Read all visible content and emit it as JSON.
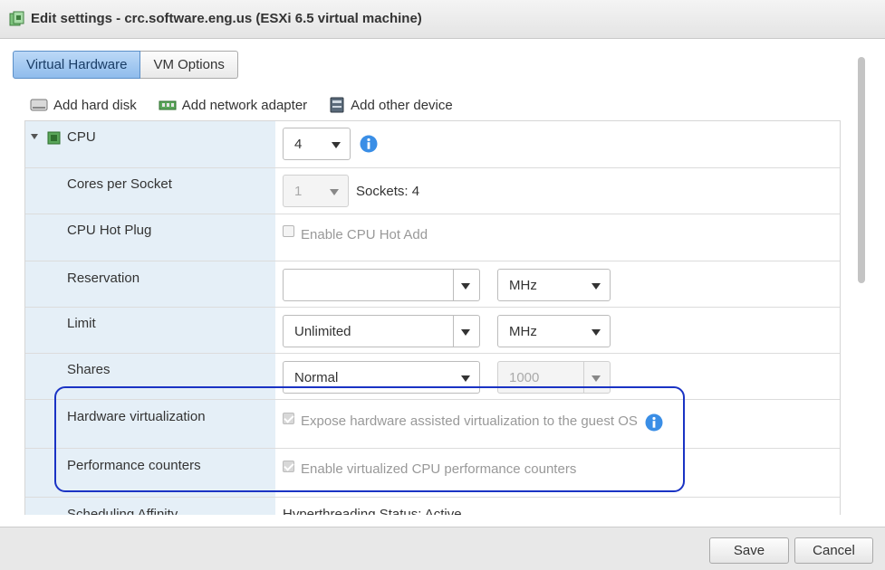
{
  "window": {
    "title": "Edit settings - crc.software.eng.us (ESXi 6.5 virtual machine)"
  },
  "tabs": [
    {
      "label": "Virtual Hardware",
      "active": true
    },
    {
      "label": "VM Options",
      "active": false
    }
  ],
  "toolbar": {
    "add_hard_disk": "Add hard disk",
    "add_network_adapter": "Add network adapter",
    "add_other_device": "Add other device"
  },
  "cpu": {
    "label": "CPU",
    "value": "4",
    "cores_per_socket": {
      "label": "Cores per Socket",
      "value": "1",
      "sockets_text": "Sockets: 4"
    },
    "hot_plug": {
      "label": "CPU Hot Plug",
      "checkbox_label": "Enable CPU Hot Add",
      "checked": false
    },
    "reservation": {
      "label": "Reservation",
      "value": "",
      "unit": "MHz"
    },
    "limit": {
      "label": "Limit",
      "value": "Unlimited",
      "unit": "MHz"
    },
    "shares": {
      "label": "Shares",
      "value": "Normal",
      "amount": "1000"
    },
    "hardware_virtualization": {
      "label": "Hardware virtualization",
      "checkbox_label": "Expose hardware assisted virtualization to the guest OS",
      "checked": true
    },
    "performance_counters": {
      "label": "Performance counters",
      "checkbox_label": "Enable virtualized CPU performance counters",
      "checked": true
    },
    "scheduling_affinity": {
      "label": "Scheduling Affinity",
      "value": "Hyperthreading Status: Active"
    }
  },
  "footer": {
    "save": "Save",
    "cancel": "Cancel"
  },
  "colors": {
    "highlight": "#1a33c4",
    "label_bg": "#e5eff7",
    "tab_active": "#8fbcec",
    "info": "#3a8ee6"
  }
}
